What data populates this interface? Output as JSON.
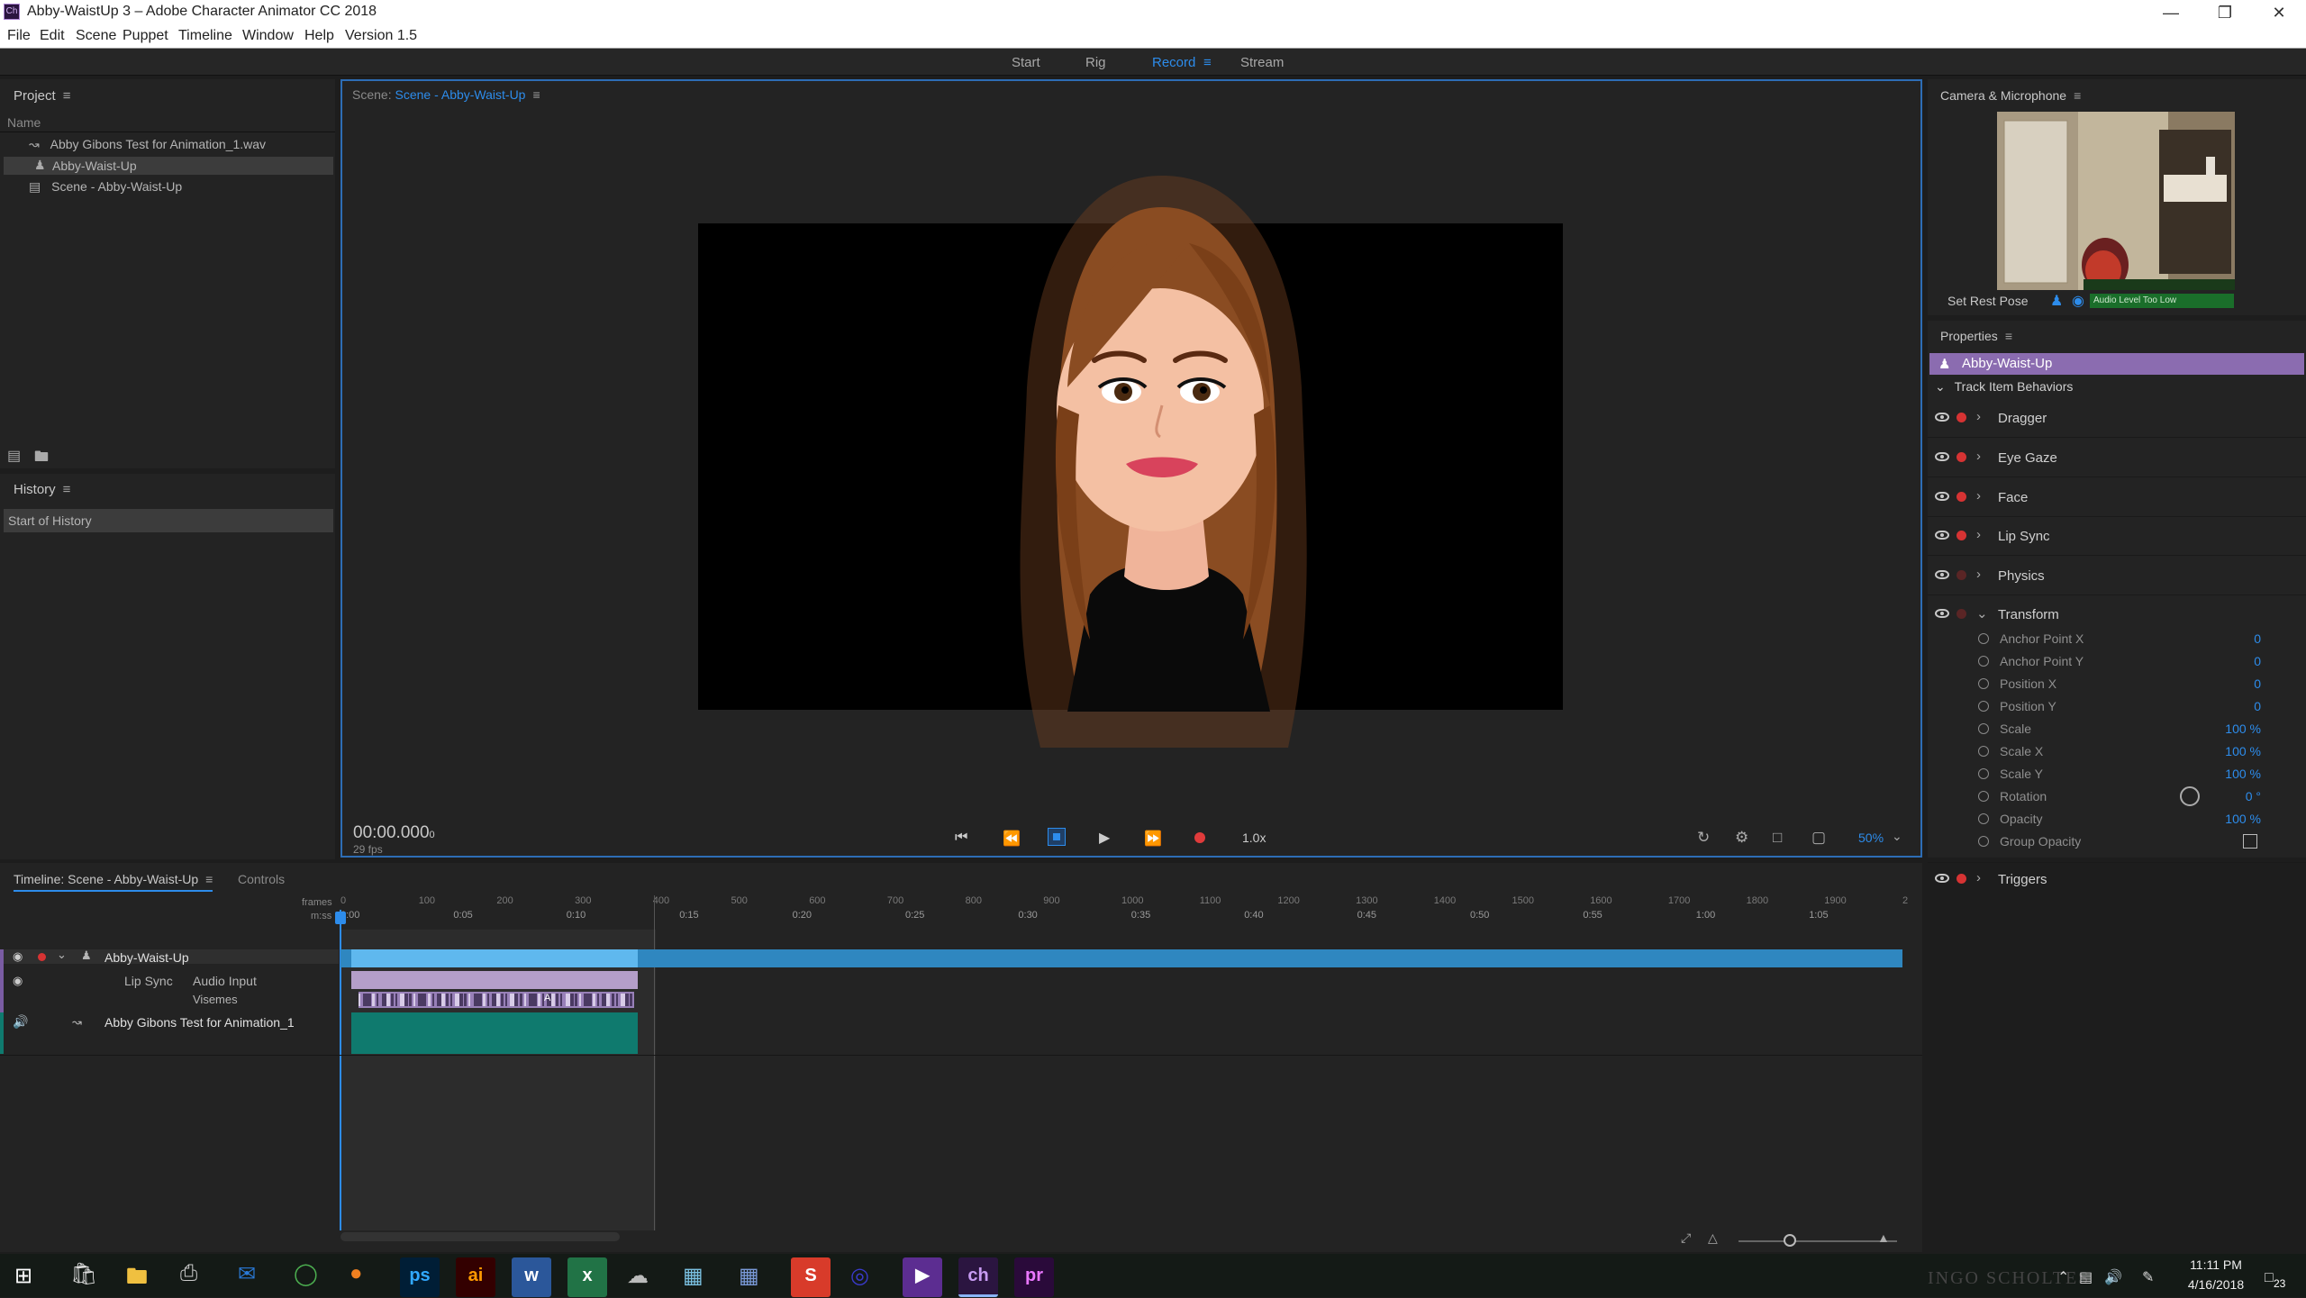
{
  "window": {
    "title": "Abby-WaistUp 3 – Adobe Character Animator CC 2018",
    "logo": "Ch"
  },
  "menu": [
    "File",
    "Edit",
    "Scene",
    "Puppet",
    "Timeline",
    "Window",
    "Help",
    "Version 1.5"
  ],
  "workspaces": {
    "start": "Start",
    "rig": "Rig",
    "record": "Record",
    "stream": "Stream"
  },
  "project": {
    "title": "Project",
    "column": "Name",
    "items": [
      "Abby Gibons Test for Animation_1.wav",
      "Abby-Waist-Up",
      "Scene - Abby-Waist-Up"
    ]
  },
  "history": {
    "title": "History",
    "items": [
      "Start of History"
    ]
  },
  "scene": {
    "label": "Scene:",
    "name": "Scene - Abby-Waist-Up",
    "time": "00:00.000",
    "time_suffix": "0",
    "fps": "29 fps",
    "speed": "1.0x",
    "zoom": "50%"
  },
  "camera": {
    "title": "Camera & Microphone",
    "set_rest_pose": "Set Rest Pose",
    "audio_status": "Audio Level Too Low"
  },
  "properties": {
    "title": "Properties",
    "puppet": "Abby-Waist-Up",
    "section": "Track Item Behaviors",
    "behaviors": [
      "Dragger",
      "Eye Gaze",
      "Face",
      "Lip Sync",
      "Physics",
      "Transform"
    ],
    "transform": [
      {
        "label": "Anchor Point X",
        "value": "0"
      },
      {
        "label": "Anchor Point Y",
        "value": "0"
      },
      {
        "label": "Position X",
        "value": "0"
      },
      {
        "label": "Position Y",
        "value": "0"
      },
      {
        "label": "Scale",
        "value": "100 %"
      },
      {
        "label": "Scale X",
        "value": "100 %"
      },
      {
        "label": "Scale Y",
        "value": "100 %"
      },
      {
        "label": "Rotation",
        "value": "0 °"
      },
      {
        "label": "Opacity",
        "value": "100 %"
      },
      {
        "label": "Group Opacity",
        "value": ""
      }
    ],
    "triggers": "Triggers"
  },
  "timeline": {
    "title": "Timeline: Scene - Abby-Waist-Up",
    "controls_tab": "Controls",
    "frames_label": "frames",
    "mss_label": "m:ss",
    "frame_ticks": [
      "0",
      "100",
      "200",
      "300",
      "400",
      "500",
      "600",
      "700",
      "800",
      "900",
      "1000",
      "1100",
      "1200",
      "1300",
      "1400",
      "1500",
      "1600",
      "1700",
      "1800",
      "1900",
      "2"
    ],
    "time_ticks": [
      "0:00",
      "0:05",
      "0:10",
      "0:15",
      "0:20",
      "0:25",
      "0:30",
      "0:35",
      "0:40",
      "0:45",
      "0:50",
      "0:55",
      "1:00",
      "1:05"
    ],
    "tracks": {
      "puppet": "Abby-Waist-Up",
      "lipsync": "Lip Sync",
      "audio_input": "Audio Input",
      "visemes": "Visemes",
      "viseme_marker": "A",
      "audio": "Abby Gibons Test for Animation_1"
    }
  },
  "taskbar": {
    "time": "11:11 PM",
    "date": "4/16/2018",
    "notifications": "23",
    "watermark": "INGO SCHOLTES",
    "apps": [
      "ps",
      "ai",
      "w",
      "x",
      "ch",
      "pr"
    ]
  },
  "colors": {
    "accent": "#2d8ceb",
    "puppet_track": "#2f87c0",
    "audio_clip": "#0f7a6e",
    "viseme": "#b49ec9",
    "selection": "#8b6cb0"
  }
}
